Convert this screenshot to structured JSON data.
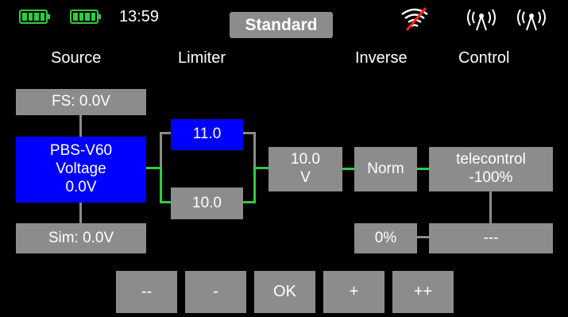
{
  "status_bar": {
    "time": "13:59",
    "mode": "Standard",
    "battery_color": "#2ecc40",
    "icons": [
      "battery-icon",
      "battery-icon",
      "wifi-off-icon",
      "antenna-icon",
      "antenna-icon"
    ]
  },
  "headers": {
    "source": "Source",
    "limiter": "Limiter",
    "inverse": "Inverse",
    "control": "Control"
  },
  "source": {
    "failsafe": "FS: 0.0V",
    "sensor_line1": "PBS-V60",
    "sensor_line2": "Voltage",
    "sensor_line3": "0.0V",
    "sim": "Sim: 0.0V"
  },
  "limiter": {
    "upper": "11.0",
    "lower": "10.0"
  },
  "value": {
    "line1": "10.0",
    "line2": "V"
  },
  "inverse": {
    "mode": "Norm",
    "percent": "0%"
  },
  "control": {
    "line1": "telecontrol",
    "line2": "-100%",
    "secondary": "---"
  },
  "buttons": {
    "dec_fast": "--",
    "dec": "-",
    "ok": "OK",
    "inc": "+",
    "inc_fast": "++"
  },
  "colors": {
    "background": "#000000",
    "box": "#8c8c8c",
    "selected": "#0000ff",
    "connector": "#2ecc40"
  }
}
